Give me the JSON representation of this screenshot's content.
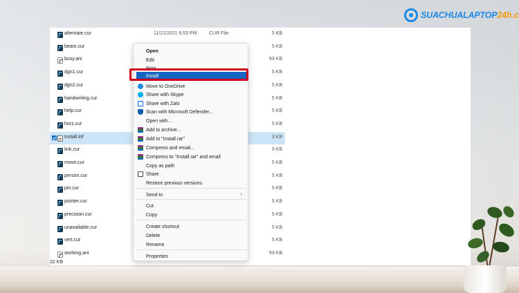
{
  "logo": {
    "text_main": "SUACHUALAPTOP",
    "text_accent": "24h.com"
  },
  "files": [
    {
      "name": "alternate.cur",
      "date": "11/21/2021 6:53 PM",
      "type": "CUR File",
      "size": "5 KB",
      "icon": "cursor-file-icon"
    },
    {
      "name": "beam.cur",
      "date": "",
      "type": "",
      "size": "5 KB",
      "icon": "cursor-file-icon"
    },
    {
      "name": "busy.ani",
      "date": "",
      "type": "",
      "size": "93 KB",
      "icon": "animated-cursor-file-icon"
    },
    {
      "name": "dgn1.cur",
      "date": "",
      "type": "",
      "size": "5 KB",
      "icon": "cursor-file-icon"
    },
    {
      "name": "dgn2.cur",
      "date": "",
      "type": "",
      "size": "5 KB",
      "icon": "cursor-file-icon"
    },
    {
      "name": "handwriting.cur",
      "date": "",
      "type": "",
      "size": "5 KB",
      "icon": "cursor-file-icon"
    },
    {
      "name": "help.cur",
      "date": "",
      "type": "",
      "size": "5 KB",
      "icon": "cursor-file-icon"
    },
    {
      "name": "horz.cur",
      "date": "",
      "type": "",
      "size": "5 KB",
      "icon": "cursor-file-icon"
    },
    {
      "name": "Install.inf",
      "date": "",
      "type": "",
      "size": "3 KB",
      "icon": "setup-info-file-icon",
      "selected": true
    },
    {
      "name": "link.cur",
      "date": "",
      "type": "",
      "size": "5 KB",
      "icon": "cursor-file-icon"
    },
    {
      "name": "move.cur",
      "date": "",
      "type": "",
      "size": "5 KB",
      "icon": "cursor-file-icon"
    },
    {
      "name": "person.cur",
      "date": "",
      "type": "",
      "size": "5 KB",
      "icon": "cursor-file-icon"
    },
    {
      "name": "pin.cur",
      "date": "",
      "type": "",
      "size": "5 KB",
      "icon": "cursor-file-icon"
    },
    {
      "name": "pointer.cur",
      "date": "",
      "type": "",
      "size": "5 KB",
      "icon": "cursor-file-icon"
    },
    {
      "name": "precision.cur",
      "date": "",
      "type": "",
      "size": "5 KB",
      "icon": "cursor-file-icon"
    },
    {
      "name": "unavailable.cur",
      "date": "",
      "type": "",
      "size": "5 KB",
      "icon": "cursor-file-icon"
    },
    {
      "name": "vert.cur",
      "date": "",
      "type": "",
      "size": "5 KB",
      "icon": "cursor-file-icon"
    },
    {
      "name": "working.ani",
      "date": "",
      "type": "",
      "size": "93 KB",
      "icon": "animated-cursor-file-icon"
    }
  ],
  "partial_text": "32 KB",
  "context_menu": {
    "items": [
      {
        "label": "Open",
        "bold": true
      },
      {
        "label": "Edit"
      },
      {
        "label": "Print"
      },
      {
        "label": "Install",
        "highlighted": true
      },
      {
        "label": "Move to OneDrive",
        "icon": "onedrive-icon"
      },
      {
        "label": "Share with Skype",
        "icon": "skype-icon"
      },
      {
        "label": "Share with Zalo",
        "icon": "zalo-icon"
      },
      {
        "label": "Scan with Microsoft Defender...",
        "icon": "defender-shield-icon"
      },
      {
        "label": "Open with..."
      },
      {
        "label": "Add to archive...",
        "icon": "winrar-icon"
      },
      {
        "label": "Add to \"Install.rar\"",
        "icon": "winrar-icon"
      },
      {
        "label": "Compress and email...",
        "icon": "winrar-icon"
      },
      {
        "label": "Compress to \"Install.rar\" and email",
        "icon": "winrar-icon"
      },
      {
        "label": "Copy as path"
      },
      {
        "label": "Share",
        "icon": "share-icon"
      },
      {
        "label": "Restore previous versions"
      },
      {
        "label": "Send to",
        "submenu": true
      },
      {
        "label": "Cut"
      },
      {
        "label": "Copy"
      },
      {
        "label": "Create shortcut"
      },
      {
        "label": "Delete"
      },
      {
        "label": "Rename"
      },
      {
        "label": "Properties"
      }
    ],
    "submenu_arrow": "›"
  },
  "colors": {
    "highlight": "#1565c0",
    "annotation_box": "#d0021b",
    "selected_row": "#cce4f7"
  }
}
